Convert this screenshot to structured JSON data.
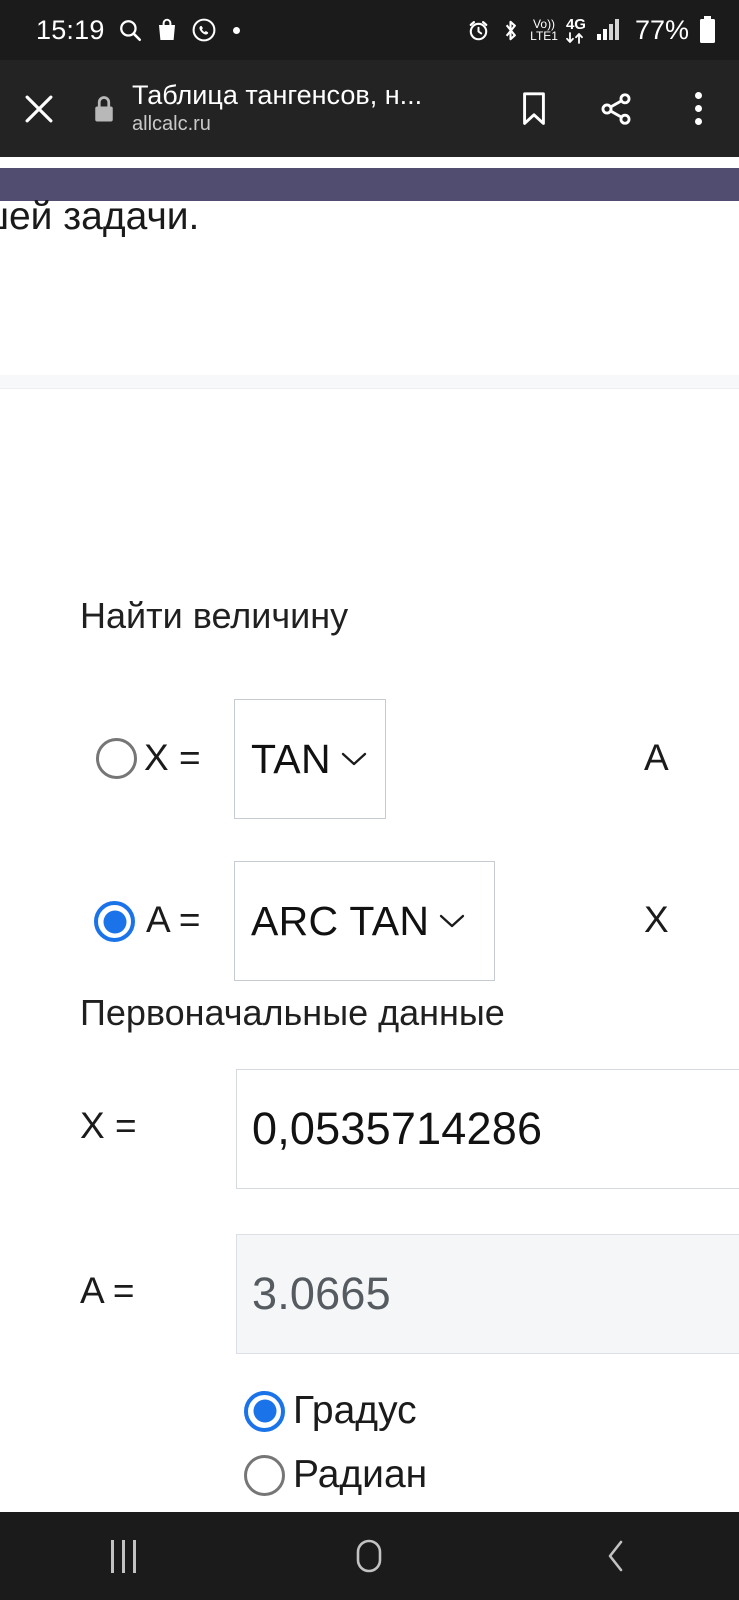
{
  "status_bar": {
    "clock": "15:19",
    "left_icons": [
      "search-icon",
      "shopping-bag-icon",
      "whatsapp-icon",
      "dot-indicator"
    ],
    "right_icons": [
      "alarm-icon",
      "bluetooth-icon",
      "volte-icon",
      "4g-data-icon",
      "signal-icon"
    ],
    "volte_top": "Vo))",
    "volte_bottom": "LTE1",
    "network_gen": "4G",
    "battery_percent": "77%"
  },
  "browser": {
    "close_label": "✕",
    "security_icon": "lock-icon",
    "title": "Таблица тангенсов, н...",
    "origin": "allcalc.ru",
    "actions": [
      "bookmark-icon",
      "share-icon",
      "more-options-icon"
    ]
  },
  "page": {
    "cut_paragraph": "ашей задачи.",
    "accent_bar_color": "#504D70"
  },
  "calculator": {
    "find_heading": "Найти величину",
    "data_heading": "Первоначальные данные",
    "mode_rows": [
      {
        "id": "mode-x",
        "selected": false,
        "lead_label": "X =",
        "function": "TAN",
        "tail_label": "A"
      },
      {
        "id": "mode-a",
        "selected": true,
        "lead_label": "A =",
        "function": "ARC TAN",
        "tail_label": "X"
      }
    ],
    "fields": [
      {
        "id": "field-x",
        "label": "X =",
        "value": "0,0535714286",
        "readonly": false
      },
      {
        "id": "field-a",
        "label": "A =",
        "value": "3.0665",
        "readonly": true
      }
    ],
    "units": [
      {
        "id": "unit-degree",
        "label": "Градус",
        "selected": true
      },
      {
        "id": "unit-radian",
        "label": "Радиан",
        "selected": false
      }
    ],
    "accent_color": "#1A73E8"
  },
  "navbar": {
    "recents_label": "recents-icon",
    "home_label": "home-icon",
    "back_label": "back-icon"
  }
}
